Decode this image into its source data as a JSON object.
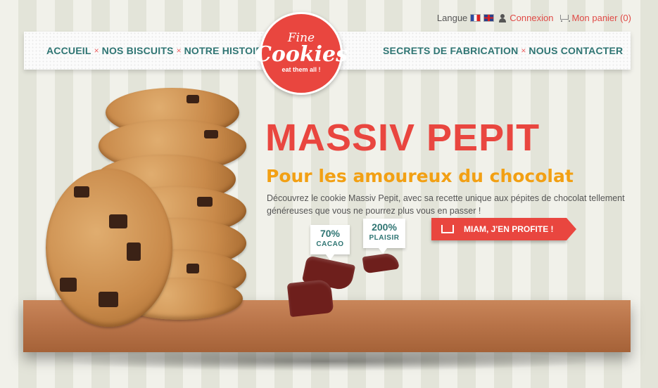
{
  "topbar": {
    "language_label": "Langue",
    "login_label": "Connexion",
    "cart_label": "Mon panier (0)"
  },
  "nav": {
    "left": [
      "ACCUEIL",
      "NOS BISCUITS",
      "NOTRE HISTOIRE"
    ],
    "right": [
      "SECRETS DE FABRICATION",
      "NOUS CONTACTER"
    ],
    "separator": "×"
  },
  "logo": {
    "fine": "Fine",
    "cookies": "Cookies",
    "tagline": "eat them all !"
  },
  "hero": {
    "title": "MASSIV PEPIT",
    "subtitle": "Pour les amoureux du chocolat",
    "text": "Découvrez le cookie Massiv Pepit, avec sa recette unique aux pépites de chocolat tellement généreuses que vous ne pourrez plus vous en passer !",
    "cta_label": "MIAM, J'EN PROFITE !",
    "badges": [
      {
        "value": "70%",
        "label": "CACAO"
      },
      {
        "value": "200%",
        "label": "PLAISIR"
      }
    ]
  },
  "colors": {
    "accent": "#e9463f",
    "nav_text": "#2f7573",
    "subtitle": "#f2a014"
  }
}
